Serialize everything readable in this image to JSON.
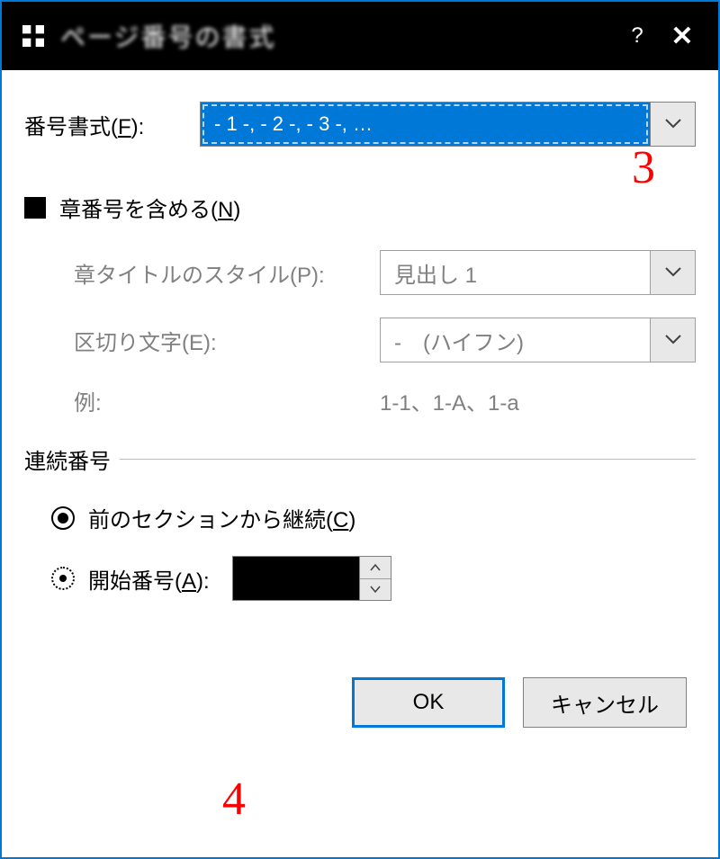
{
  "title": "ページ番号の書式",
  "titlebar": {
    "help": "?",
    "close": "✕"
  },
  "format": {
    "label_prefix": "番号書式(",
    "label_accel": "F",
    "label_suffix": "):",
    "value": "- 1 -, - 2 -, - 3 -, …"
  },
  "chapter": {
    "checkbox_prefix": "章番号を含める(",
    "checkbox_accel": "N",
    "checkbox_suffix": ")",
    "style_label": "章タイトルのスタイル(P):",
    "style_value": "見出し 1",
    "sep_label": "区切り文字(E):",
    "sep_value": "-　(ハイフン)",
    "example_label": "例:",
    "example_value": "1-1、1-A、1-a"
  },
  "numbering": {
    "header": "連続番号",
    "continue_prefix": "前のセクションから継続(",
    "continue_accel": "C",
    "continue_suffix": ")",
    "start_prefix": "開始番号(",
    "start_accel": "A",
    "start_suffix": "):",
    "start_value": ""
  },
  "buttons": {
    "ok": "OK",
    "cancel": "キャンセル"
  },
  "annotations": {
    "num3": "3",
    "num4": "4"
  }
}
